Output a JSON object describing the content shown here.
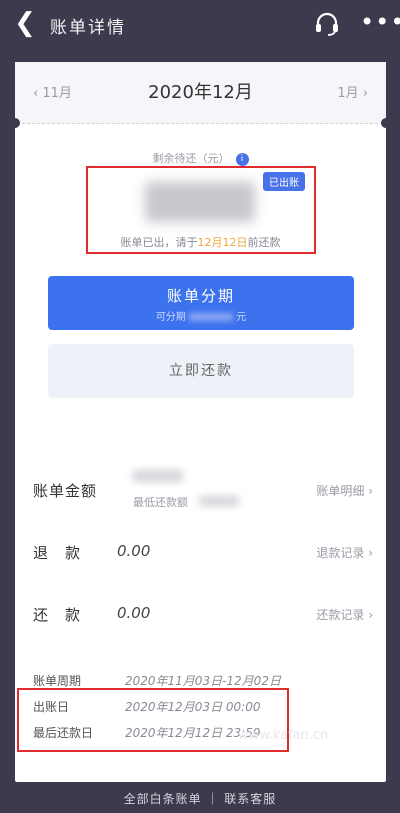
{
  "header": {
    "title": "账单详情",
    "back_icon": "chevron-left-icon",
    "service_icon": "headset-icon",
    "more_icon": "more-dots-icon"
  },
  "month": {
    "prev": "11月",
    "current": "2020年12月",
    "next": "1月"
  },
  "summary": {
    "label": "剩余待还（元）",
    "badge": "已出账",
    "hint_prefix": "账单已出，请于",
    "hint_date": "12月12日",
    "hint_suffix": "前还款"
  },
  "buttons": {
    "installment": "账单分期",
    "installment_sub": "可分期",
    "installment_sub_end": "元",
    "repay": "立即还款"
  },
  "rows": {
    "bill_amount": {
      "label": "账单金额",
      "sub": "最低还款额",
      "link": "账单明细"
    },
    "refund": {
      "label": "退　款",
      "value": "0.00",
      "link": "退款记录"
    },
    "repaid": {
      "label": "还　款",
      "value": "0.00",
      "link": "还款记录"
    }
  },
  "dates": [
    {
      "label": "账单周期",
      "value": "2020年11月03日-12月02日"
    },
    {
      "label": "出账日",
      "value": "2020年12月03日 00:00"
    },
    {
      "label": "最后还款日",
      "value": "2020年12月12日 23:59"
    }
  ],
  "footer": {
    "text": "全部白条账单 ｜ 联系客服"
  },
  "watermark": "www.kafan.cn",
  "colors": {
    "primary": "#3d72ee",
    "highlight": "#e02c2c",
    "accent": "#f0a73c"
  }
}
